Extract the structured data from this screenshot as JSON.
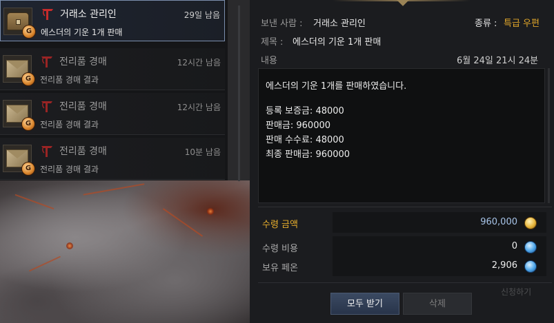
{
  "mail_list": [
    {
      "sender": "거래소 관리인",
      "time_left": "29일 남음",
      "subject": "에스더의 기운 1개 판매",
      "selected": true,
      "icon": "chest-icon"
    },
    {
      "sender": "전리품 경매",
      "time_left": "12시간 남음",
      "subject": "전리품 경매 결과",
      "selected": false,
      "icon": "envelope-icon"
    },
    {
      "sender": "전리품 경매",
      "time_left": "12시간 남음",
      "subject": "전리품 경매 결과",
      "selected": false,
      "icon": "envelope-icon"
    },
    {
      "sender": "전리품 경매",
      "time_left": "10분 남음",
      "subject": "전리품 경매 결과",
      "selected": false,
      "icon": "envelope-icon"
    }
  ],
  "detail": {
    "sender_label": "보낸 사람 :",
    "sender_value": "거래소 관리인",
    "type_label": "종류 :",
    "type_value": "특급 우편",
    "subject_label": "제목 :",
    "subject_value": "에스더의 기운 1개 판매",
    "content_label": "내용",
    "date": "6월 24일 21시 24분",
    "content_lines": [
      "에스더의 기운 1개를 판매하였습니다.",
      "",
      "등록 보증금: 48000",
      "판매금: 960000",
      "판매 수수료: 48000",
      "최종 판매금: 960000"
    ]
  },
  "money": {
    "receive_amount_label": "수령 금액",
    "receive_amount_value": "960,000",
    "receive_cost_label": "수령 비용",
    "receive_cost_value": "0",
    "owned_label": "보유 페온",
    "owned_value": "2,906"
  },
  "buttons": {
    "receive_all": "모두 받기",
    "delete": "삭제"
  },
  "ghost_text": "신청하기",
  "colors": {
    "accent_gold": "#e6ad2c",
    "selection_border": "#7c8fae",
    "sender_mark": "#c62b2b"
  }
}
